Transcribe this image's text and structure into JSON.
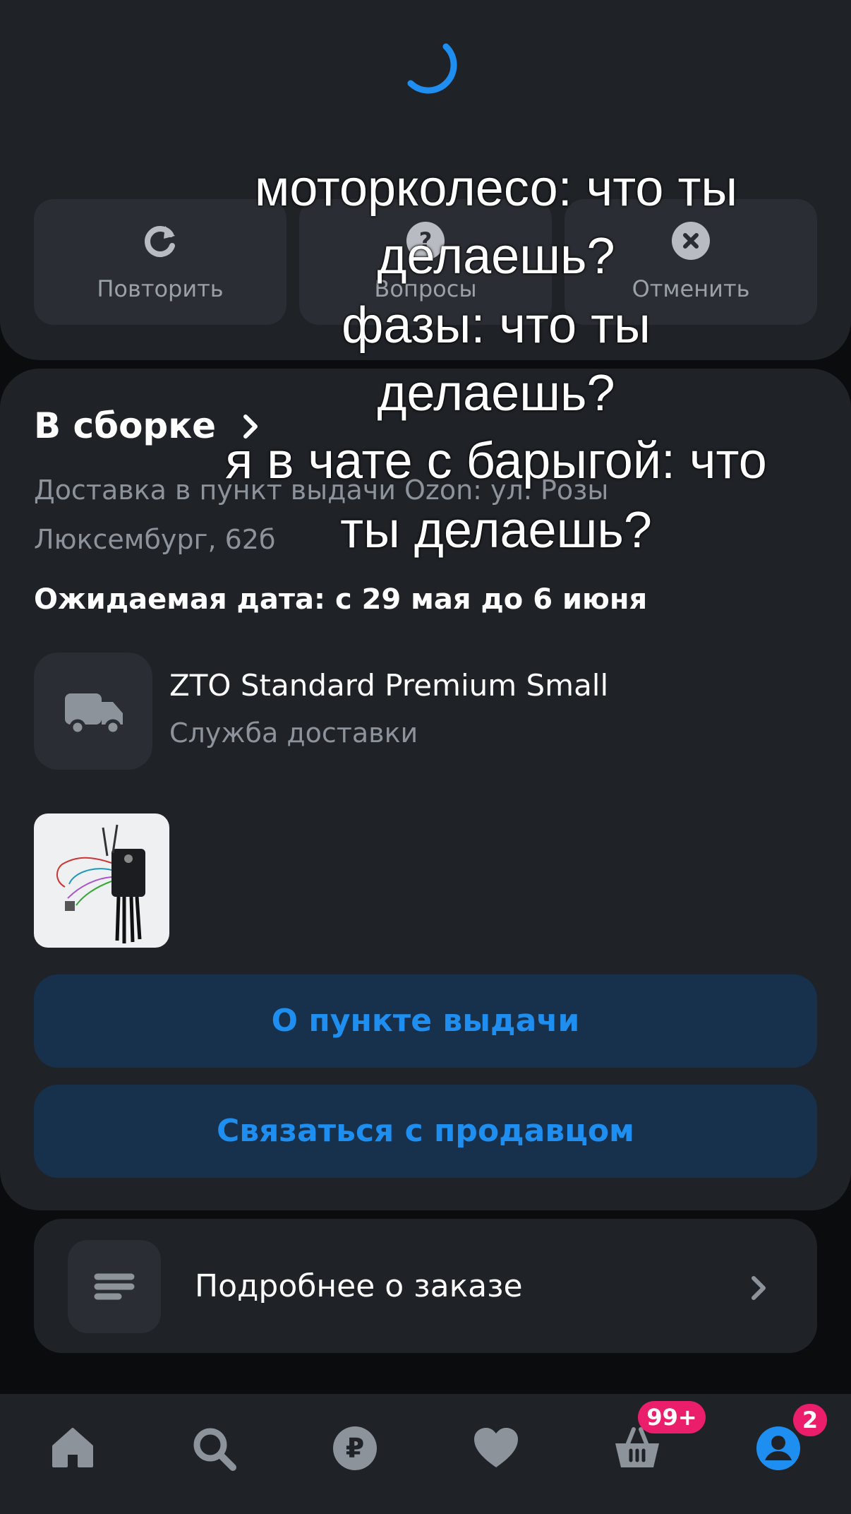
{
  "actions": {
    "repeat_label": "Повторить",
    "questions_label": "Вопросы",
    "cancel_label": "Отменить"
  },
  "order": {
    "status": "В сборке",
    "address_line1": "Доставка в пункт выдачи Ozon: ул. Розы",
    "address_line2": "Люксембург, 62б",
    "eta": "Ожидаемая дата: с 29 мая до 6 июня",
    "service_name": "ZTO Standard Premium Small",
    "service_sub": "Служба доставки",
    "pickup_button": "О пункте выдачи",
    "contact_button": "Связаться с продавцом",
    "details_label": "Подробнее о заказе"
  },
  "tabbar": {
    "cart_badge": "99+",
    "profile_badge": "2"
  },
  "caption": {
    "line1": "моторколесо: что ты",
    "line2": "делаешь?",
    "line3": "фазы: что ты",
    "line4": "делаешь?",
    "line5": "я в чате с барыгой: что",
    "line6": "ты делаешь?"
  },
  "colors": {
    "accent": "#1e8ff0",
    "badge": "#ea1e6a",
    "card": "#1f2227"
  }
}
